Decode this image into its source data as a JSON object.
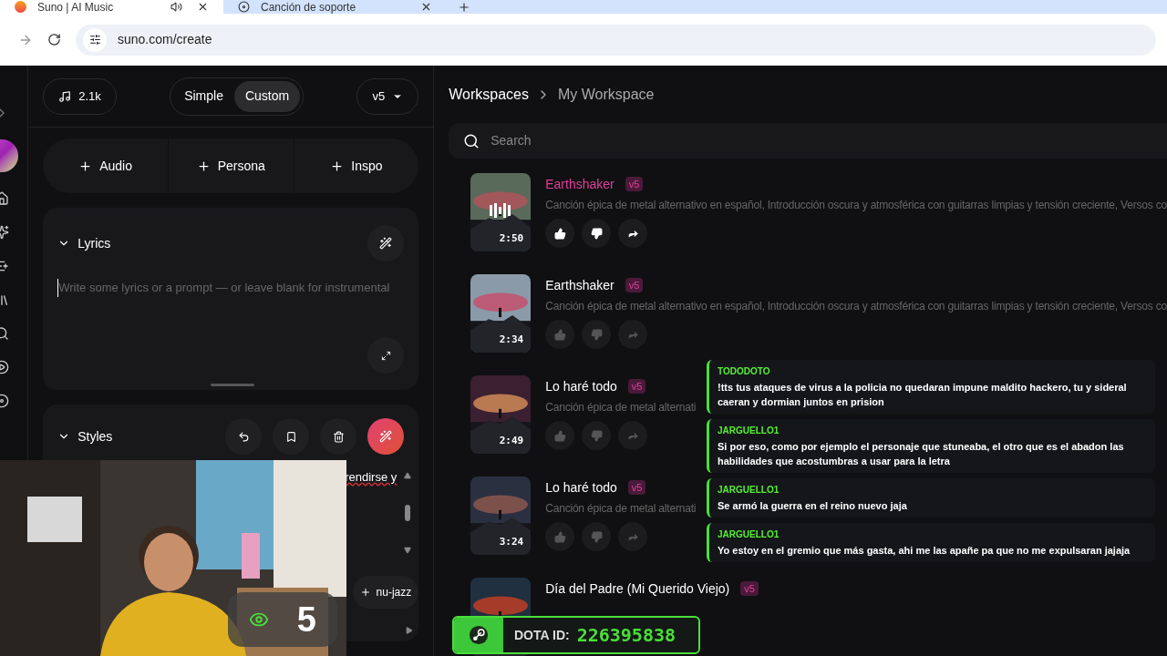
{
  "browser": {
    "tabs": [
      {
        "title": "Suno | AI Music",
        "selected": true,
        "audio": true
      },
      {
        "title": "Canción de soporte",
        "selected": false,
        "audio": false
      }
    ],
    "url": "suno.com/create"
  },
  "composer": {
    "credits": "2.1k",
    "modes": [
      {
        "label": "Simple",
        "selected": false
      },
      {
        "label": "Custom",
        "selected": true
      }
    ],
    "model": "v5",
    "add_buttons": [
      "Audio",
      "Persona",
      "Inspo"
    ],
    "lyrics": {
      "title": "Lyrics",
      "placeholder": "Write some lyrics or a prompt — or leave blank for instrumental"
    },
    "styles": {
      "title": "Styles",
      "text": "rendirse y",
      "tag": "nu-jazz"
    }
  },
  "workspace": {
    "breadcrumb": [
      "Workspaces",
      "My Workspace"
    ],
    "search_placeholder": "Search",
    "songs": [
      {
        "title": "Earthshaker",
        "model": "v5",
        "duration": "2:50",
        "active": true,
        "description": "Canción épica de metal alternativo en español, Introducción oscura y atmosférica con guitarras limpias y tensión creciente, Versos co"
      },
      {
        "title": "Earthshaker",
        "model": "v5",
        "duration": "2:34",
        "active": false,
        "description": "Canción épica de metal alternativo en español, Introducción oscura y atmosférica con guitarras limpias y tensión creciente, Versos co"
      },
      {
        "title": "Lo haré todo",
        "model": "v5",
        "duration": "2:49",
        "active": false,
        "description": "Canción épica de metal alternati"
      },
      {
        "title": "Lo haré todo",
        "model": "v5",
        "duration": "3:24",
        "active": false,
        "description": "Canción épica de metal alternati"
      },
      {
        "title": "Día del Padre (Mi Querido Viejo)",
        "model": "v5",
        "active": false
      }
    ]
  },
  "chat": [
    {
      "user": "TODODOTO",
      "message": "!tts tus ataques de virus a la policia no quedaran impune maldito hackero, tu y sideral caeran y dormian juntos en prision"
    },
    {
      "user": "JARGUELLO1",
      "message": "Si por eso, como por ejemplo el personaje que stuneaba, el otro que es el abadon las habilidades que acostumbras a usar para la letra"
    },
    {
      "user": "JARGUELLO1",
      "message": "Se armó la guerra en el reino nuevo jaja"
    },
    {
      "user": "JARGUELLO1",
      "message": "Yo estoy en el gremio que más gasta, ahi me las apañe pa que no me expulsaran jajaja"
    }
  ],
  "stream": {
    "viewers": "5",
    "dota_label": "DOTA ID:",
    "dota_id": "226395838"
  }
}
